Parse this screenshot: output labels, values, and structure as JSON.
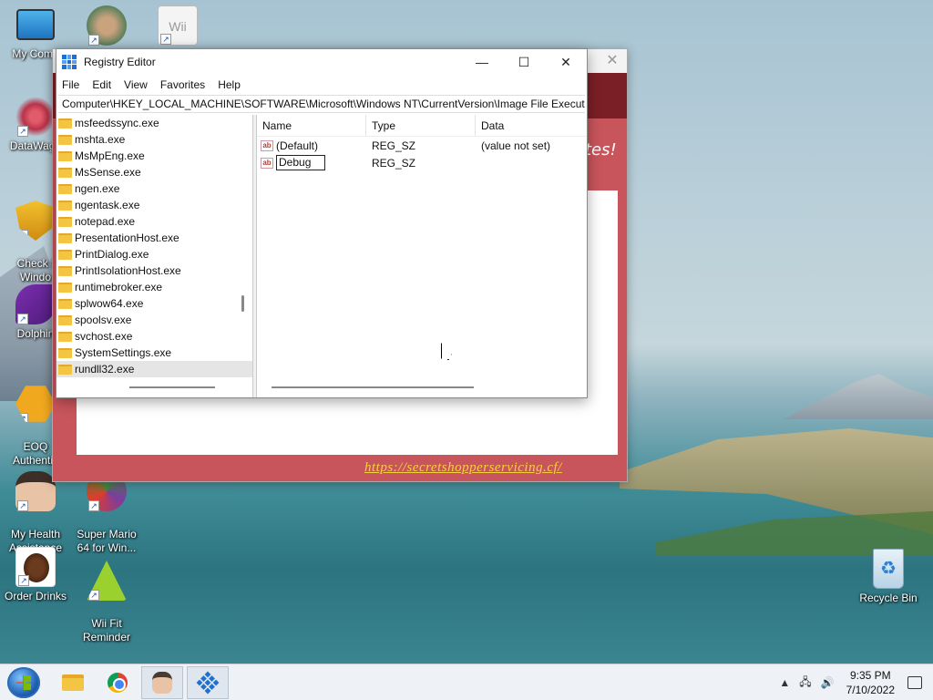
{
  "desktop": {
    "icons": [
      {
        "label": "My Comp",
        "icon": "computer-icon"
      },
      {
        "label": "",
        "icon": "user-photo-icon"
      },
      {
        "label": "",
        "icon": "wii-icon"
      },
      {
        "label": "DataWago",
        "icon": "datawago-icon"
      },
      {
        "label": "Check f\nWindo",
        "icon": "shield-icon"
      },
      {
        "label": "Dolphin",
        "icon": "dolphin-icon"
      },
      {
        "label": "EOQ\nAuthentic",
        "icon": "key-icon"
      },
      {
        "label": "My Health\nAssistance",
        "icon": "avatar-icon"
      },
      {
        "label": "Super Mario\n64 for Win...",
        "icon": "mario-icon"
      },
      {
        "label": "Order Drinks",
        "icon": "coffee-icon"
      },
      {
        "label": "Wii Fit\nReminder",
        "icon": "wii-fit-icon"
      },
      {
        "label": "Recycle Bin",
        "icon": "recycle-bin-icon"
      }
    ],
    "wii_text": "Wii"
  },
  "scam_window": {
    "partial_text": "tes!",
    "link": "https://secretshopperservicing.cf/",
    "close_label": "✕"
  },
  "registry": {
    "title": "Registry Editor",
    "menu": [
      "File",
      "Edit",
      "View",
      "Favorites",
      "Help"
    ],
    "address": "Computer\\HKEY_LOCAL_MACHINE\\SOFTWARE\\Microsoft\\Windows NT\\CurrentVersion\\Image File Executior",
    "tree": [
      "msfeedssync.exe",
      "mshta.exe",
      "MsMpEng.exe",
      "MsSense.exe",
      "ngen.exe",
      "ngentask.exe",
      "notepad.exe",
      "PresentationHost.exe",
      "PrintDialog.exe",
      "PrintIsolationHost.exe",
      "runtimebroker.exe",
      "splwow64.exe",
      "spoolsv.exe",
      "svchost.exe",
      "SystemSettings.exe",
      "rundll32.exe"
    ],
    "selected_tree_item": "rundll32.exe",
    "columns": {
      "name": "Name",
      "type": "Type",
      "data": "Data"
    },
    "values": [
      {
        "name": "(Default)",
        "type": "REG_SZ",
        "data": "(value not set)"
      },
      {
        "name": "Debug",
        "type": "REG_SZ",
        "data": ""
      }
    ],
    "icon_text": "ab"
  },
  "taskbar": {
    "time": "9:35 PM",
    "date": "7/10/2022",
    "tray_up": "▲"
  },
  "colors": {
    "scam_red": "#c8555b",
    "scam_dark": "#7a1f26",
    "link_yellow": "#f6d23a"
  }
}
